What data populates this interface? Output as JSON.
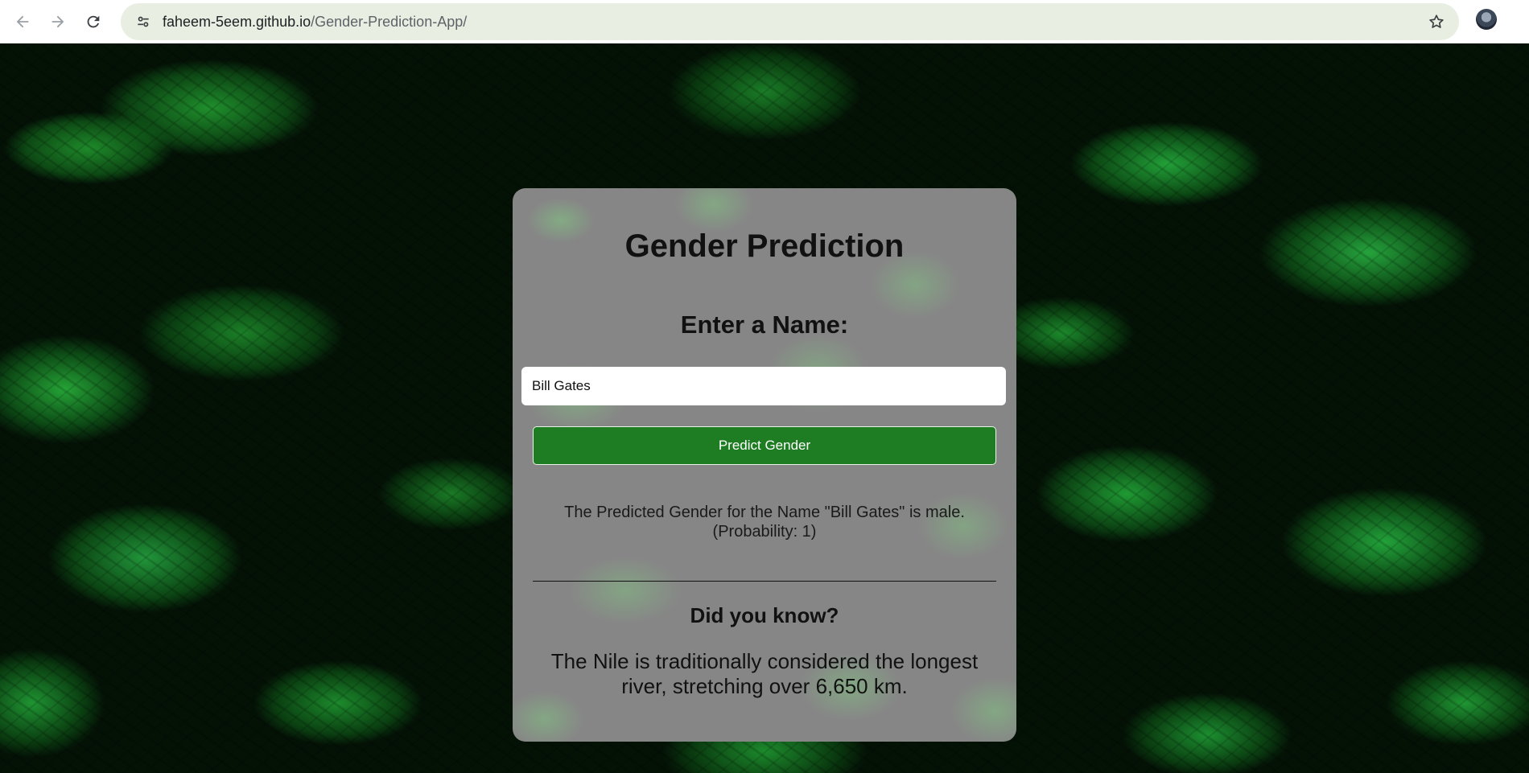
{
  "browser": {
    "url_host": "faheem-5eem.github.io",
    "url_path": "/Gender-Prediction-App/",
    "icons": {
      "back": "arrow-left-icon",
      "forward": "arrow-right-icon",
      "reload": "reload-icon",
      "site_info": "tune-icon",
      "bookmark": "star-icon",
      "profile": "avatar"
    }
  },
  "app": {
    "title": "Gender Prediction",
    "name_label": "Enter a Name:",
    "name_input_value": "Bill Gates",
    "predict_button_label": "Predict Gender",
    "result_line1": "The Predicted Gender for the Name \"Bill Gates\" is male.",
    "result_line2": "(Probability: 1)",
    "did_you_know_heading": "Did you know?",
    "did_you_know_fact": "The Nile is traditionally considered the longest river, stretching over 6,650 km."
  },
  "colors": {
    "button_green": "#1e7d22",
    "card_gray": "#868686",
    "omnibox_bg": "#e8efe2"
  }
}
